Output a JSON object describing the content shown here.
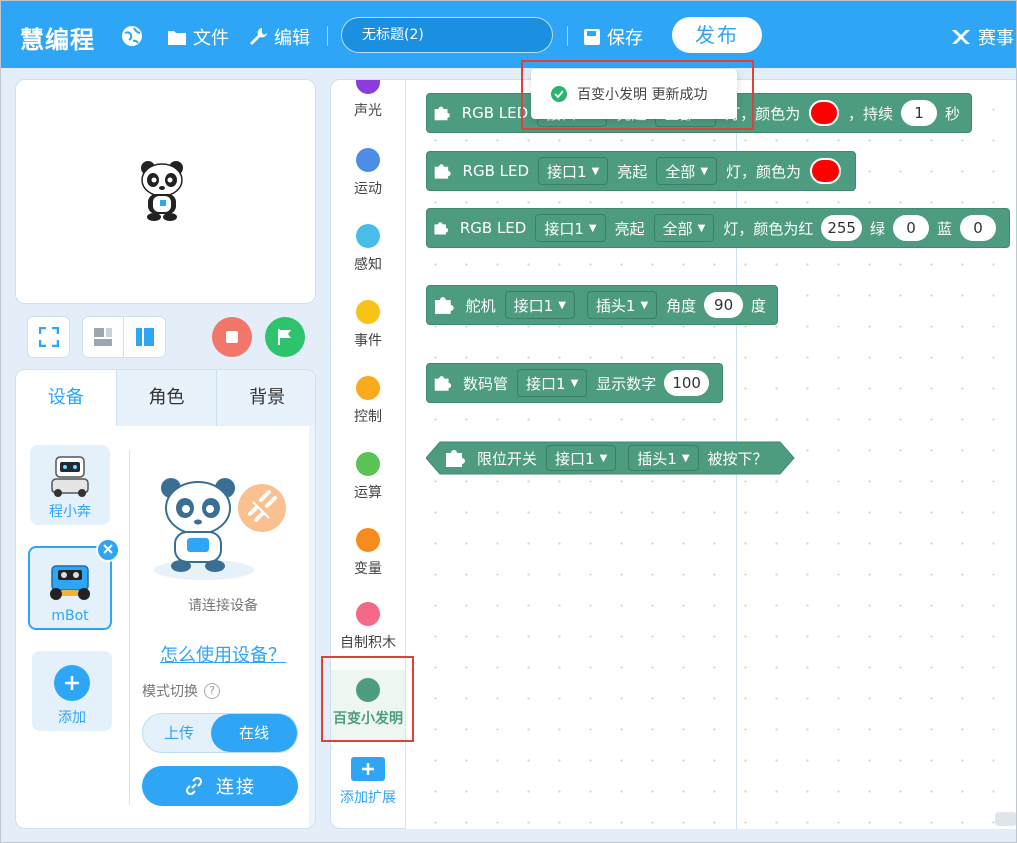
{
  "topbar": {
    "logo": "慧编程",
    "file_label": "文件",
    "edit_label": "编辑",
    "project_title": "无标题(2)",
    "save_label": "保存",
    "publish_label": "发布",
    "contest_label": "赛事"
  },
  "stage_tabs": [
    "设备",
    "角色",
    "背景"
  ],
  "devices": [
    {
      "label": "程小奔"
    },
    {
      "label": "mBot"
    },
    {
      "label": "添加"
    }
  ],
  "device_panel": {
    "connect_hint": "请连接设备",
    "howto_link": "怎么使用设备？",
    "mode_label": "模式切换",
    "mode_help": "?",
    "mode_upload": "上传",
    "mode_online": "在线",
    "connect_button": "连接"
  },
  "categories": [
    {
      "label": "声光",
      "color": "#8a3ddc"
    },
    {
      "label": "运动",
      "color": "#4c8ee6"
    },
    {
      "label": "感知",
      "color": "#48bde8"
    },
    {
      "label": "事件",
      "color": "#f7c317"
    },
    {
      "label": "控制",
      "color": "#f9aa1c"
    },
    {
      "label": "运算",
      "color": "#5bc255"
    },
    {
      "label": "变量",
      "color": "#f98a1c"
    },
    {
      "label": "自制积木",
      "color": "#f36987"
    },
    {
      "label": "百变小发明",
      "color": "#4d9c7f"
    }
  ],
  "add_extension": "添加扩展",
  "toast": {
    "message": "百变小发明 更新成功"
  },
  "blocks": {
    "b1": {
      "name": "RGB LED",
      "port": "接口1",
      "action": "亮起",
      "scope": "全部",
      "light": "灯，颜色为",
      "dur": "，持续",
      "secs": "1",
      "unit": "秒"
    },
    "b2": {
      "name": "RGB LED",
      "port": "接口1",
      "action": "亮起",
      "scope": "全部",
      "light": "灯，颜色为"
    },
    "b3": {
      "name": "RGB LED",
      "port": "接口1",
      "action": "亮起",
      "scope": "全部",
      "light": "灯，颜色为红",
      "r": "255",
      "g_label": "绿",
      "g": "0",
      "b_label": "蓝",
      "b": "0"
    },
    "b4": {
      "name": "舵机",
      "port": "接口1",
      "plug": "插头1",
      "angle_label": "角度",
      "angle": "90",
      "unit": "度"
    },
    "b5": {
      "name": "数码管",
      "port": "接口1",
      "show": "显示数字",
      "value": "100"
    },
    "b6": {
      "name": "限位开关",
      "port": "接口1",
      "plug": "插头1",
      "pressed": "被按下？"
    }
  },
  "colors": {
    "accent": "#2ea5f5",
    "block": "#4d9c7f",
    "highlight": "#e0403a"
  }
}
